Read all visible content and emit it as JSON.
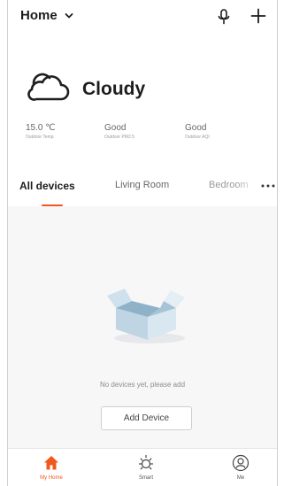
{
  "header": {
    "home_title": "Home",
    "chevron_icon": "chevron-down-icon",
    "mic_icon": "microphone-icon",
    "add_icon": "plus-icon"
  },
  "weather": {
    "icon": "cloud-icon",
    "condition": "Cloudy",
    "stats": [
      {
        "value": "15.0 ℃",
        "label": "Outdoor Temp"
      },
      {
        "value": "Good",
        "label": "Outdoor PM2.5"
      },
      {
        "value": "Good",
        "label": "Outdoor AQI"
      }
    ]
  },
  "tabs": [
    {
      "label": "All devices",
      "active": true
    },
    {
      "label": "Living Room",
      "active": false
    },
    {
      "label": "Bedroom",
      "active": false
    }
  ],
  "more_icon": "more-horizontal-icon",
  "empty_state": {
    "icon": "empty-box-icon",
    "message": "No devices yet, please add",
    "button_label": "Add Device"
  },
  "bottom_nav": [
    {
      "label": "My Home",
      "icon": "home-icon",
      "active": true
    },
    {
      "label": "Smart",
      "icon": "sun-icon",
      "active": false
    },
    {
      "label": "Me",
      "icon": "user-icon",
      "active": false
    }
  ],
  "colors": {
    "accent": "#f0581f",
    "background": "#f7f7f8",
    "header_background": "#ffffff"
  }
}
